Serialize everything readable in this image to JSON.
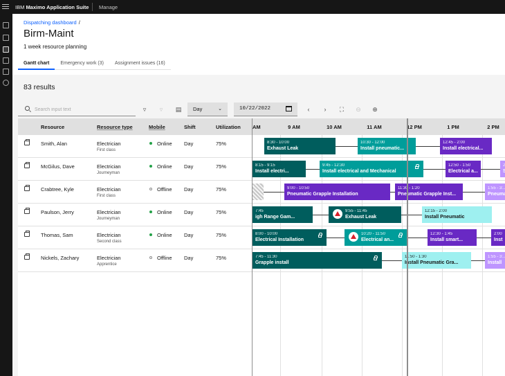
{
  "app": {
    "brand_prefix": "IBM",
    "brand_name": "Maximo Application Suite",
    "module": "Manage"
  },
  "breadcrumb": {
    "link": "Dispatching dashboard",
    "separator": "/"
  },
  "page": {
    "title": "Birm-Maint",
    "subtitle": "1 week resource planning"
  },
  "tabs": [
    {
      "label": "Gantt chart",
      "active": true
    },
    {
      "label": "Emergency work (3)",
      "active": false
    },
    {
      "label": "Assignment issues (16)",
      "active": false
    }
  ],
  "results": "83 results",
  "toolbar": {
    "search_placeholder": "Search input text",
    "view_select": "Day",
    "date": "10/22/2022"
  },
  "table": {
    "headers": {
      "resource": "Resource",
      "resource_type": "Resource type",
      "mobile": "Mobile",
      "shift": "Shift",
      "utilization": "Utilization"
    },
    "rows": [
      {
        "name": "Smith, Alan",
        "type": "Electrician",
        "level": "First class",
        "mobile": "Online",
        "online": true,
        "shift": "Day",
        "utilization": "75%"
      },
      {
        "name": "McGilus, Dave",
        "type": "Electrician",
        "level": "Journeyman",
        "mobile": "Online",
        "online": true,
        "shift": "Day",
        "utilization": "75%"
      },
      {
        "name": "Crabtree, Kyle",
        "type": "Electrician",
        "level": "First class",
        "mobile": "Offline",
        "online": false,
        "shift": "Day",
        "utilization": "75%"
      },
      {
        "name": "Paulson, Jerry",
        "type": "Electrician",
        "level": "Journeyman",
        "mobile": "Online",
        "online": true,
        "shift": "Day",
        "utilization": "75%"
      },
      {
        "name": "Thomas, Sam",
        "type": "Electrician",
        "level": "Second class",
        "mobile": "Online",
        "online": true,
        "shift": "Day",
        "utilization": "75%"
      },
      {
        "name": "Nickels, Zachary",
        "type": "Electrician",
        "level": "Apprentice",
        "mobile": "Offline",
        "online": false,
        "shift": "Day",
        "utilization": "75%"
      }
    ]
  },
  "gantt": {
    "hours": [
      "AM",
      "9 AM",
      "10 AM",
      "11 AM",
      "12 PM",
      "1 PM",
      "2 PM"
    ],
    "rows": [
      [
        {
          "time": "8:30 - 10:00",
          "name": "Exhaust Leak",
          "color": "dark"
        },
        {
          "time": "10:30 - 12:00",
          "name": "Install pneumatic...",
          "color": "teal"
        },
        {
          "time": "12:45 - 2:00",
          "name": "Install electrical...",
          "color": "purple"
        }
      ],
      [
        {
          "time": "8:15 - 9:15",
          "name": "Install electri...",
          "color": "dark"
        },
        {
          "time": "9:45 - 12:30",
          "name": "Install electrical and Mechanical",
          "color": "teal",
          "locked": true
        },
        {
          "time": "12:50 - 1:50",
          "name": "Electrical a...",
          "color": "purple"
        },
        {
          "time": "2:...",
          "name": "S",
          "color": "lilac"
        }
      ],
      [
        {
          "time": "",
          "name": "",
          "color": "hatch"
        },
        {
          "time": "9:00 - 10:50",
          "name": "Pneumatic Grapple Installation",
          "color": "purple"
        },
        {
          "time": "11:30 - 1:20",
          "name": "Pneumatic Grapple Inst...",
          "color": "purple"
        },
        {
          "time": "1:55 - 3:...",
          "name": "Pneuma",
          "color": "lilac"
        }
      ],
      [
        {
          "time": "7:45",
          "name": "igh Range Gam...",
          "color": "dark"
        },
        {
          "time": "9:55 - 11:45",
          "name": "Exhaust Leak",
          "color": "dark",
          "warning": true
        },
        {
          "time": "12:15 - 2:00",
          "name": "Install Pneumatic",
          "color": "cyan"
        }
      ],
      [
        {
          "time": "8:00 - 10:00",
          "name": "Electrical Installation",
          "color": "dark",
          "locked": true
        },
        {
          "time": "10:20 - 11:50",
          "name": "Electrical an...",
          "color": "teal",
          "warning": true,
          "locked": true
        },
        {
          "time": "12:30 - 1:45",
          "name": "Install smart...",
          "color": "purple"
        },
        {
          "time": "2:00",
          "name": "Inst",
          "color": "purple"
        }
      ],
      [
        {
          "time": "7:45 - 11:30",
          "name": "Grapple install",
          "color": "dark",
          "locked": true
        },
        {
          "time": "11:50 - 1:30",
          "name": "Install Pneumatic Gra...",
          "color": "cyan"
        },
        {
          "time": "1:55 - 3:...",
          "name": "Install",
          "color": "lilac"
        }
      ]
    ]
  }
}
